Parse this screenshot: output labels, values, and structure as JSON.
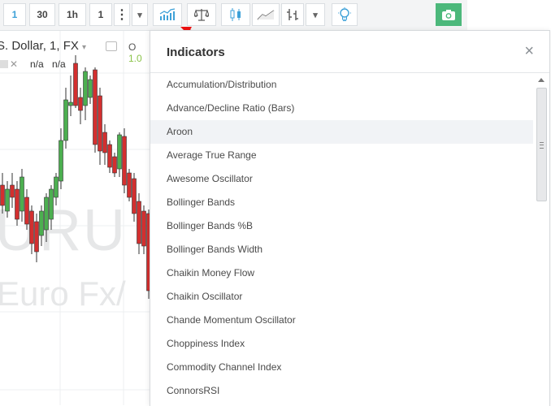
{
  "toolbar": {
    "active_interval": "1",
    "intervals": [
      "30",
      "1h",
      "1"
    ],
    "more_glyph": "⋮",
    "dropdown_glyph": "▾",
    "icons": [
      "indicators-icon",
      "compare-icon",
      "candles-icon",
      "line-chart-icon",
      "bars-icon",
      "idea-bulb-icon",
      "camera-icon"
    ],
    "colors": {
      "active": "#3ea1d8",
      "camera_bg": "#4cb87b"
    }
  },
  "chart": {
    "title": "S. Dollar, 1, FX",
    "ohlc_label": "O",
    "ohlc_value": "1.0",
    "na_1": "n/a",
    "na_2": "n/a",
    "watermark_line1": "URU",
    "watermark_line2": "Euro Fx/",
    "colors": {
      "up": "#4caf50",
      "down": "#d32f2f"
    }
  },
  "dialog": {
    "title": "Indicators",
    "close": "×",
    "items": [
      "Accumulation/Distribution",
      "Advance/Decline Ratio (Bars)",
      "Aroon",
      "Average True Range",
      "Awesome Oscillator",
      "Bollinger Bands",
      "Bollinger Bands %B",
      "Bollinger Bands Width",
      "Chaikin Money Flow",
      "Chaikin Oscillator",
      "Chande Momentum Oscillator",
      "Choppiness Index",
      "Commodity Channel Index",
      "ConnorsRSI"
    ],
    "highlighted": "Aroon"
  }
}
